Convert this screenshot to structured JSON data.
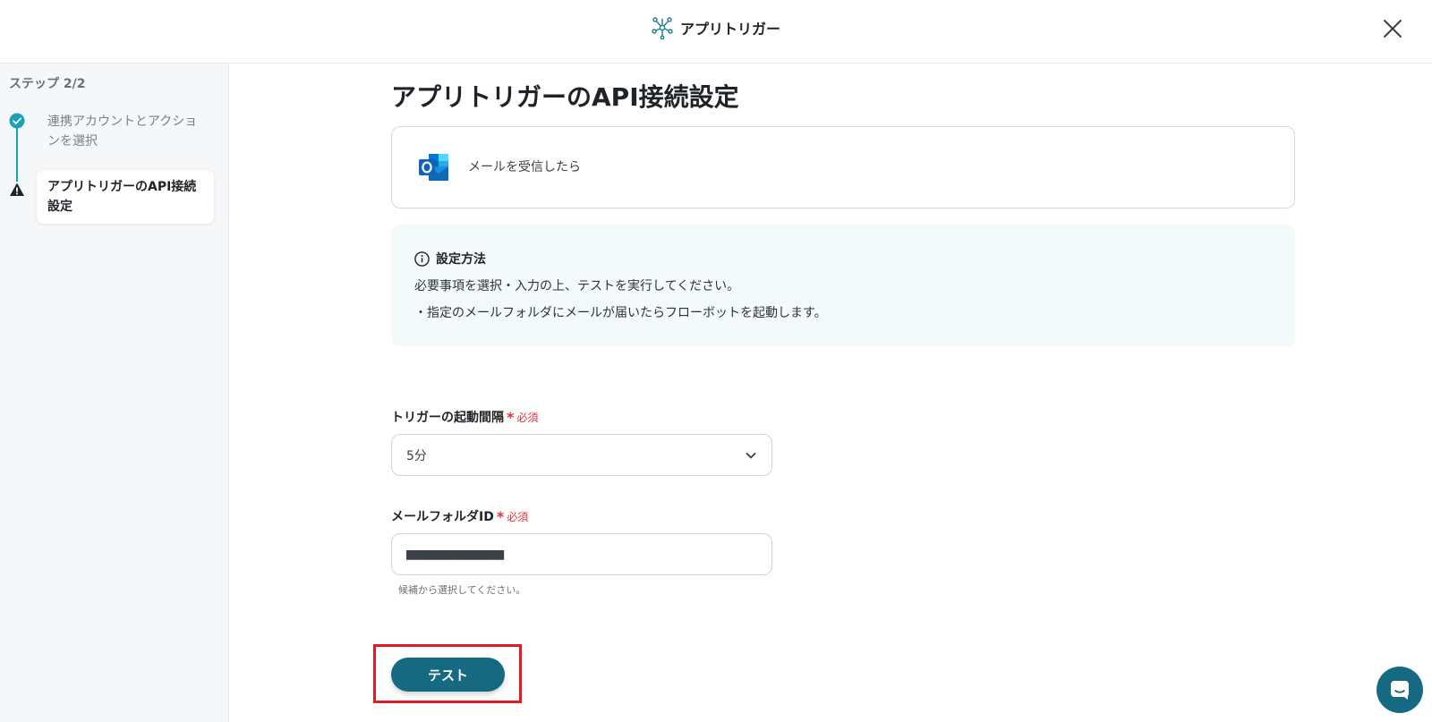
{
  "header": {
    "title": "アプリトリガー",
    "icon": "network-nodes-icon",
    "close_icon": "close-icon"
  },
  "sidebar": {
    "step_count": "ステップ 2/2",
    "steps": [
      {
        "label": "連携アカウントとアクションを選択",
        "status": "completed"
      },
      {
        "label": "アプリトリガーのAPI接続設定",
        "status": "warning"
      }
    ]
  },
  "main": {
    "title": "アプリトリガーのAPI接続設定",
    "app_card": {
      "icon": "outlook-icon",
      "label": "メールを受信したら"
    },
    "info": {
      "heading": "設定方法",
      "lines": [
        "必要事項を選択・入力の上、テストを実行してください。",
        "・指定のメールフォルダにメールが届いたらフローボットを起動します。"
      ]
    },
    "fields": {
      "interval": {
        "label": "トリガーの起動間隔",
        "required_mark": "*",
        "required_text": "必須",
        "value": "5分"
      },
      "folder_id": {
        "label": "メールフォルダID",
        "required_mark": "*",
        "required_text": "必須",
        "value": "■■■■■■■■■■■",
        "hint": "候補から選択してください。"
      }
    },
    "test_button": "テスト"
  },
  "colors": {
    "accent": "#156a82",
    "step_line": "#17a2b8",
    "required": "#e5333b",
    "highlight": "#e01b24",
    "info_bg": "#f3faf9"
  }
}
